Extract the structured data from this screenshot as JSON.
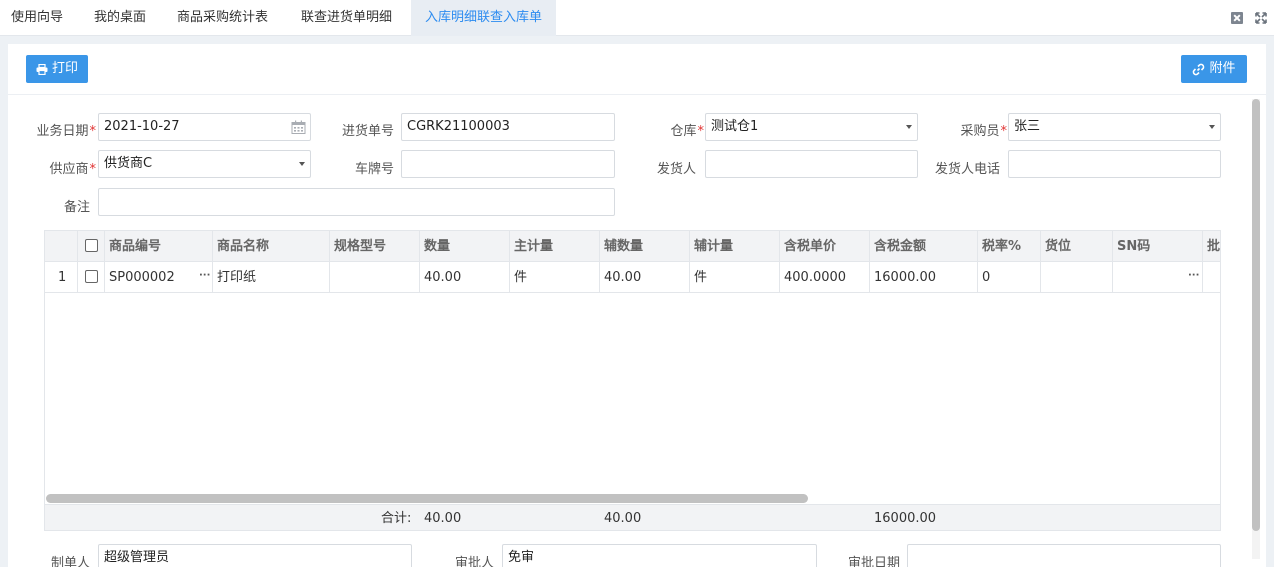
{
  "tabs": [
    {
      "label": "使用向导",
      "active": false
    },
    {
      "label": "我的桌面",
      "active": false
    },
    {
      "label": "商品采购统计表",
      "active": false
    },
    {
      "label": "联查进货单明细",
      "active": false
    },
    {
      "label": "入库明细联查入库单",
      "active": true
    }
  ],
  "window_controls": {
    "close_icon": "close-box-icon",
    "fullscreen_icon": "fullscreen-icon"
  },
  "toolbar": {
    "print_label": "打印",
    "attachment_label": "附件",
    "print_icon": "printer-icon",
    "attachment_icon": "link-icon"
  },
  "colors": {
    "accent": "#2d8cf0",
    "button": "#3a96e8",
    "required": "#e03131"
  },
  "form": {
    "business_date": {
      "label": "业务日期",
      "required": true,
      "value": "2021-10-27"
    },
    "purchase_no": {
      "label": "进货单号",
      "value": "CGRK21100003"
    },
    "warehouse": {
      "label": "仓库",
      "required": true,
      "value": "测试仓1"
    },
    "purchaser": {
      "label": "采购员",
      "required": true,
      "value": "张三"
    },
    "supplier": {
      "label": "供应商",
      "required": true,
      "value": "供货商C"
    },
    "plate_no": {
      "label": "车牌号",
      "value": ""
    },
    "shipper": {
      "label": "发货人",
      "value": ""
    },
    "shipper_phone": {
      "label": "发货人电话",
      "value": ""
    },
    "remark": {
      "label": "备注",
      "value": ""
    }
  },
  "grid": {
    "columns": [
      "商品编号",
      "商品名称",
      "规格型号",
      "数量",
      "主计量",
      "辅数量",
      "辅计量",
      "含税单价",
      "含税金额",
      "税率%",
      "货位",
      "SN码",
      "批"
    ],
    "rows": [
      {
        "index": "1",
        "code": "SP000002",
        "name": "打印纸",
        "spec": "",
        "qty": "40.00",
        "unit": "件",
        "aux_qty": "40.00",
        "aux_unit": "件",
        "price": "400.0000",
        "amount": "16000.00",
        "tax": "0",
        "location": "",
        "sn": ""
      }
    ],
    "footer": {
      "label": "合计:",
      "qty": "40.00",
      "aux_qty": "40.00",
      "amount": "16000.00"
    }
  },
  "bottom": {
    "maker": {
      "label": "制单人",
      "value": "超级管理员"
    },
    "approver": {
      "label": "审批人",
      "value": "免审"
    },
    "approve_date": {
      "label": "审批日期",
      "value": ""
    }
  }
}
